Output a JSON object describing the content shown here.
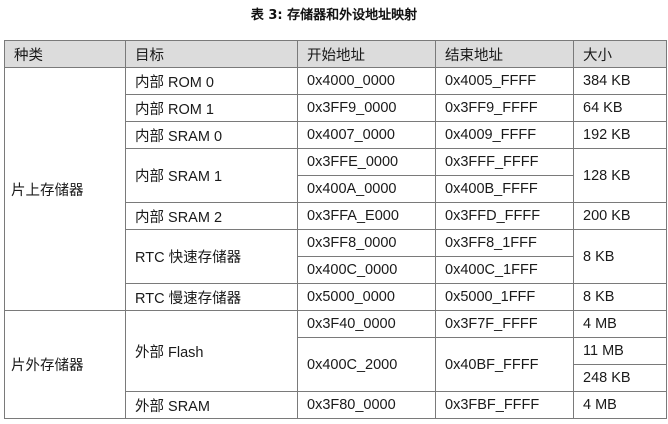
{
  "title": "表 3: 存储器和外设地址映射",
  "headers": [
    "种类",
    "目标",
    "开始地址",
    "结束地址",
    "大小"
  ],
  "internal": {
    "category": "片上存储器",
    "rom0": {
      "target": "内部 ROM 0",
      "start": "0x4000_0000",
      "end": "0x4005_FFFF",
      "size": "384 KB"
    },
    "rom1": {
      "target": "内部 ROM 1",
      "start": "0x3FF9_0000",
      "end": "0x3FF9_FFFF",
      "size": "64 KB"
    },
    "sram0": {
      "target": "内部 SRAM 0",
      "start": "0x4007_0000",
      "end": "0x4009_FFFF",
      "size": "192 KB"
    },
    "sram1": {
      "target": "内部 SRAM 1",
      "start_a": "0x3FFE_0000",
      "end_a": "0x3FFF_FFFF",
      "start_b": "0x400A_0000",
      "end_b": "0x400B_FFFF",
      "size": "128 KB"
    },
    "sram2": {
      "target": "内部 SRAM 2",
      "start": "0x3FFA_E000",
      "end": "0x3FFD_FFFF",
      "size": "200 KB"
    },
    "rtc_fast": {
      "target": "RTC 快速存储器",
      "start_a": "0x3FF8_0000",
      "end_a": "0x3FF8_1FFF",
      "start_b": "0x400C_0000",
      "end_b": "0x400C_1FFF",
      "size": "8 KB"
    },
    "rtc_slow": {
      "target": "RTC 慢速存储器",
      "start": "0x5000_0000",
      "end": "0x5000_1FFF",
      "size": "8 KB"
    }
  },
  "external": {
    "category": "片外存储器",
    "flash": {
      "target": "外部 Flash",
      "start_a": "0x3F40_0000",
      "end_a": "0x3F7F_FFFF",
      "size_a": "4 MB",
      "start_b": "0x400C_2000",
      "end_b": "0x40BF_FFFF",
      "size_b1": "11 MB",
      "size_b2": "248 KB"
    },
    "sram": {
      "target": "外部 SRAM",
      "start": "0x3F80_0000",
      "end": "0x3FBF_FFFF",
      "size": "4 MB"
    }
  }
}
